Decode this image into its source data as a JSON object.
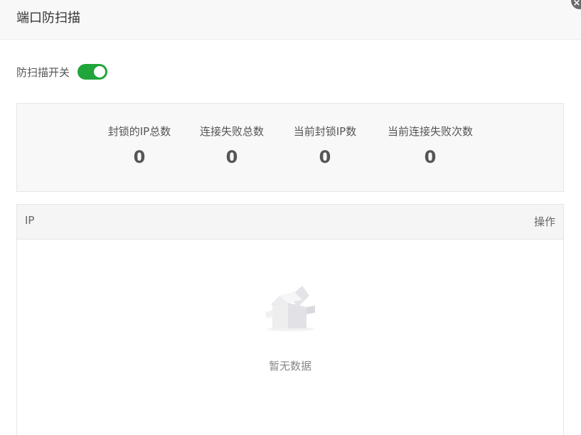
{
  "dialog": {
    "title": "端口防扫描",
    "close_symbol": "×"
  },
  "switch": {
    "label": "防扫描开关",
    "enabled": true,
    "color": "#20a53a"
  },
  "stats": [
    {
      "label": "封锁的IP总数",
      "value": "0"
    },
    {
      "label": "连接失败总数",
      "value": "0"
    },
    {
      "label": "当前封锁IP数",
      "value": "0"
    },
    {
      "label": "当前连接失败次数",
      "value": "0"
    }
  ],
  "table": {
    "columns": [
      "IP",
      "操作"
    ],
    "rows": [],
    "empty_text": "暂无数据"
  },
  "icons": {
    "empty_state": "empty-box-icon",
    "close": "close-icon"
  }
}
